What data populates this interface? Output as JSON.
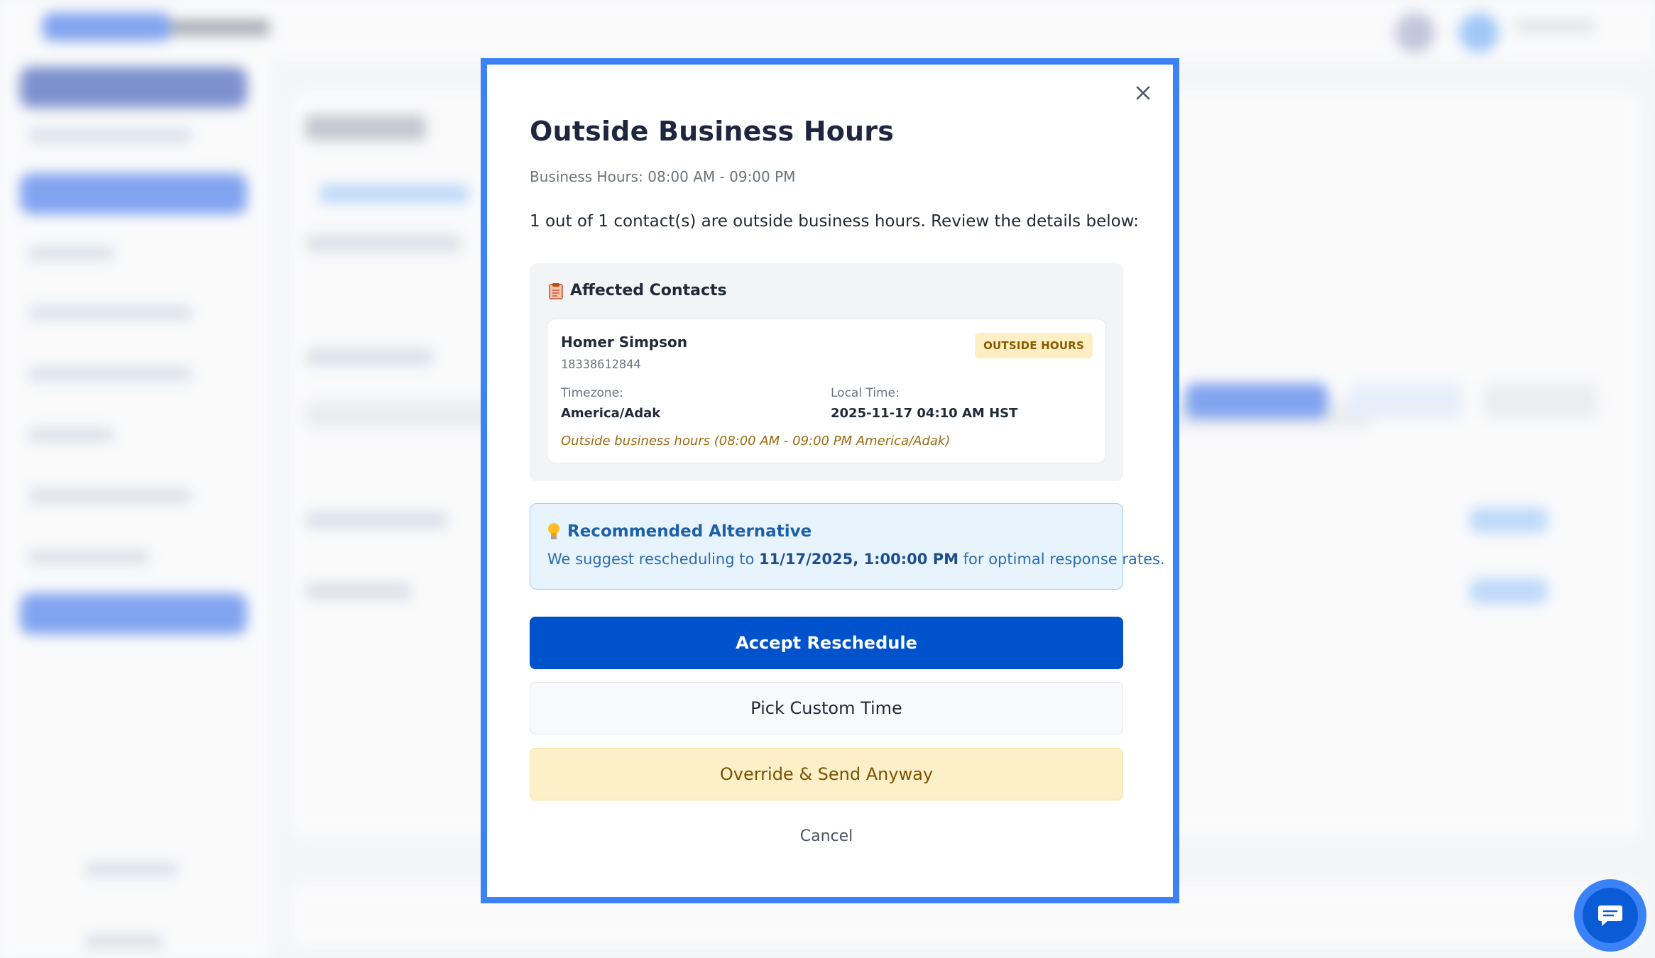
{
  "modal": {
    "title": "Outside Business Hours",
    "business_hours": "Business Hours: 08:00 AM - 09:00 PM",
    "summary": "1 out of 1 contact(s) are outside business hours. Review the details below:",
    "affected": {
      "heading": "Affected Contacts",
      "icon": "clipboard-icon",
      "contacts": [
        {
          "name": "Homer Simpson",
          "phone": "18338612844",
          "badge": "OUTSIDE HOURS",
          "timezone_label": "Timezone:",
          "timezone": "America/Adak",
          "local_time_label": "Local Time:",
          "local_time": "2025-11-17 04:10 AM HST",
          "warning": "Outside business hours (08:00 AM - 09:00 PM America/Adak)"
        }
      ]
    },
    "recommendation": {
      "icon": "lightbulb-icon",
      "heading": "Recommended Alternative",
      "text_before": "We suggest rescheduling to ",
      "suggested_time": "11/17/2025, 1:00:00 PM",
      "text_after": " for optimal response rates."
    },
    "buttons": {
      "accept": "Accept Reschedule",
      "custom": "Pick Custom Time",
      "override": "Override & Send Anyway",
      "cancel": "Cancel"
    },
    "close_icon": "close-icon"
  },
  "chat_widget": {
    "icon": "chat-icon"
  },
  "colors": {
    "primary": "#0052cc",
    "highlight_border": "#3b82f6",
    "warning_bg": "#fdf0c8",
    "info_bg": "#e8f4fd"
  }
}
